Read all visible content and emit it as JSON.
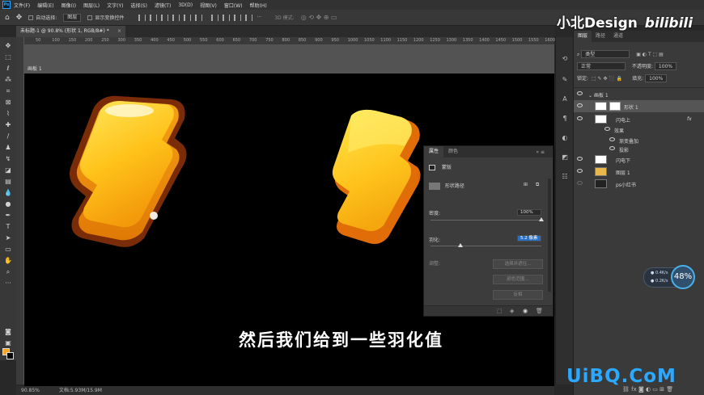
{
  "menu": [
    "文件(F)",
    "编辑(E)",
    "图像(I)",
    "图层(L)",
    "文字(Y)",
    "选择(S)",
    "滤镜(T)",
    "3D(D)",
    "视图(V)",
    "窗口(W)",
    "帮助(H)"
  ],
  "options": {
    "auto_select_label": "自动选择:",
    "auto_select_value": "图层",
    "show_transform_label": "显示变换控件",
    "mode_3d_label": "3D 模式:"
  },
  "document": {
    "tab_title": "未标题-1 @ 90.8% (形状 1, RGB/8#) *",
    "close": "×",
    "artboard_label": "画板 1"
  },
  "ruler_ticks": [
    "50",
    "100",
    "150",
    "200",
    "250",
    "300",
    "350",
    "400",
    "450",
    "500",
    "550",
    "600",
    "650",
    "700",
    "750",
    "800",
    "850",
    "900",
    "950",
    "1000",
    "1050",
    "1100",
    "1150",
    "1200",
    "1250",
    "1300",
    "1350",
    "1400",
    "1450",
    "1500",
    "1550",
    "1600"
  ],
  "status": {
    "zoom": "90.85%",
    "doc_info": "文档:5.93M/15.9M"
  },
  "subtitle": "然后我们给到一些羽化值",
  "properties": {
    "tab_properties": "属性",
    "tab_color": "颜色",
    "mask_label": "蒙版",
    "shape_path_label": "形状路径",
    "density_label": "密度:",
    "density_value": "100%",
    "density_fraction": 1.0,
    "feather_label": "羽化:",
    "feather_value": "5.2 像素",
    "feather_fraction": 0.27,
    "refine_label": "调整:",
    "btn_select_mask": "选择并遮住...",
    "btn_color_range": "颜色范围...",
    "btn_invert": "反相"
  },
  "layers": {
    "tabs": [
      "图层",
      "路径",
      "通道"
    ],
    "kind_label": "类型",
    "blend_mode": "正常",
    "opacity_label": "不透明度:",
    "opacity_value": "100%",
    "lock_label": "锁定:",
    "fill_label": "填充:",
    "fill_value": "100%",
    "rows": [
      {
        "name": "画板 1"
      },
      {
        "name": "形状 1"
      },
      {
        "name": "闪电上"
      },
      {
        "name": "效果"
      },
      {
        "name": "渐变叠加"
      },
      {
        "name": "投影"
      },
      {
        "name": "闪电下"
      },
      {
        "name": "图层 1"
      },
      {
        "name": "ps小红书"
      }
    ],
    "fx": "fx"
  },
  "watermarks": {
    "top": "小北Design",
    "top_logo": "bilibili",
    "bottom": "UiBQ.CoM"
  },
  "net": {
    "up": "0.4K/s",
    "down": "0.2K/s",
    "percent": "48%"
  },
  "colors": {
    "foreground": "#f5a623",
    "background": "#000000",
    "accent": "#31a8ff"
  }
}
